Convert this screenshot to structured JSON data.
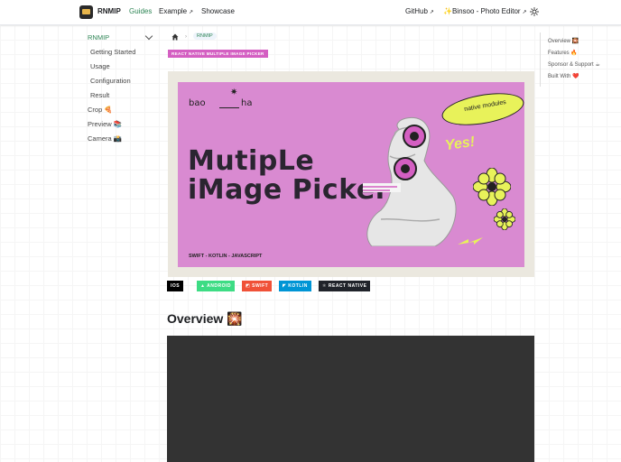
{
  "nav": {
    "brand": "RNMIP",
    "guides": "Guides",
    "example": "Example",
    "showcase": "Showcase",
    "github": "GitHub",
    "binsoo": "✨Binsoo - Photo Editor",
    "ext_icon": "↗"
  },
  "sidebar": {
    "items": [
      {
        "label": "RNMIP"
      },
      {
        "label": "Getting Started"
      },
      {
        "label": "Usage"
      },
      {
        "label": "Configuration"
      },
      {
        "label": "Result"
      },
      {
        "label": "Crop 🍕"
      },
      {
        "label": "Preview 📚"
      },
      {
        "label": "Camera 📸"
      }
    ]
  },
  "breadcrumb": {
    "sep": "›",
    "current": "RNMIP"
  },
  "header_badge": "REACT NATIVE MULTIPLE IMAGE PICKER",
  "banner": {
    "logo_left": "bao",
    "logo_right": "ha",
    "title_line1": "MutipLe",
    "title_line2": "iMage Picker",
    "pill": "native modules",
    "yes": "Yes!",
    "subtitle": "SWIFT - KOTLIN - JAVASCRIPT"
  },
  "tech_badges": [
    {
      "label": "IOS",
      "color": "#000000"
    },
    {
      "label": "ANDROID",
      "color": "#3ddc84"
    },
    {
      "label": "SWIFT",
      "color": "#f05138"
    },
    {
      "label": "KOTLIN",
      "color": "#0095d5"
    },
    {
      "label": "REACT NATIVE",
      "color": "#20232a"
    }
  ],
  "overview_heading": "Overview 🎇",
  "toc": [
    {
      "label": "Overview 🎇"
    },
    {
      "label": "Features 🔥"
    },
    {
      "label": "Sponsor & Support ☕"
    },
    {
      "label": "Built With ❤️"
    }
  ],
  "colors": {
    "accent": "#2e8555",
    "banner_bg": "#d98ad1",
    "banner_frame": "#ebe8df",
    "video_bg": "#333333"
  }
}
